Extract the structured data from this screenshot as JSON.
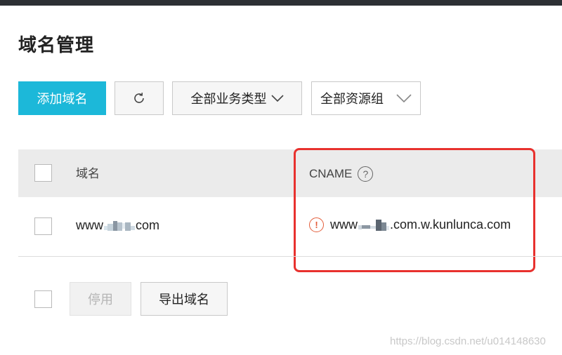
{
  "page": {
    "title": "域名管理"
  },
  "toolbar": {
    "add_label": "添加域名",
    "refresh_icon": "refresh-icon",
    "biz_type_label": "全部业务类型",
    "resource_group_label": "全部资源组"
  },
  "table": {
    "columns": {
      "domain": "域名",
      "cname": "CNAME"
    },
    "rows": [
      {
        "domain_prefix": "www",
        "domain_suffix": "com",
        "cname_prefix": "www",
        "cname_suffix": ".com.w.kunlunca.com",
        "status_icon": "warning-icon"
      }
    ]
  },
  "footer": {
    "disable_label": "停用",
    "export_label": "导出域名"
  },
  "watermark": "https://blog.csdn.net/u014148630",
  "colors": {
    "primary": "#1cb8d9",
    "highlight": "#e8312e",
    "warning": "#e35d3a"
  }
}
